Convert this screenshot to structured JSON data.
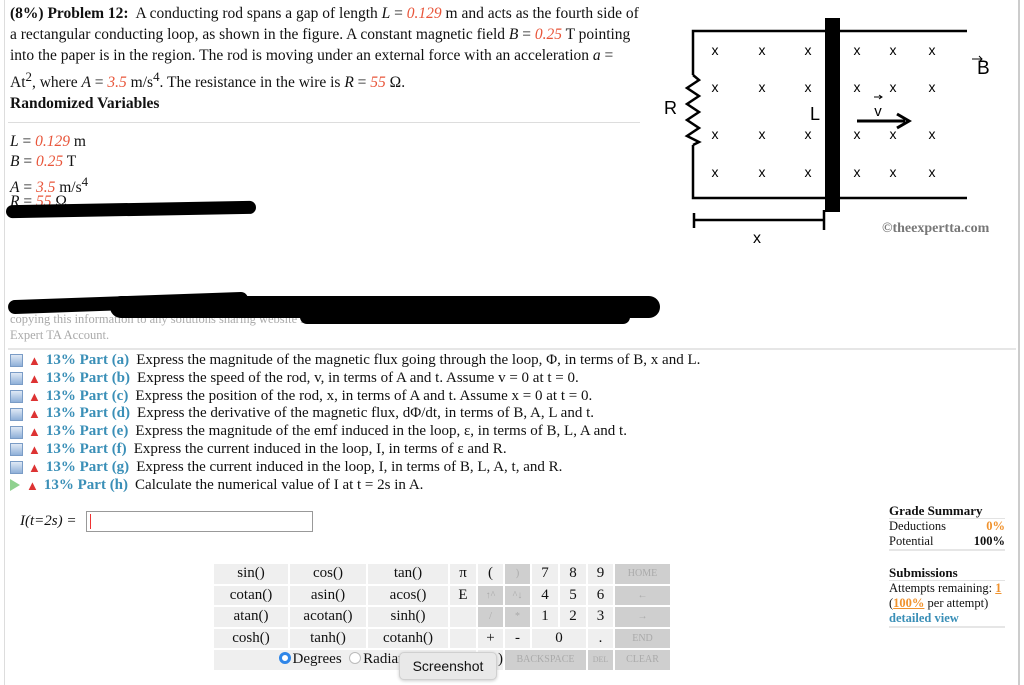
{
  "problem": {
    "weight": "(8%)",
    "title": "Problem 12:",
    "text_1": "A conducting rod spans a gap of length ",
    "L_sym": "L",
    "L_val": "0.129",
    "text_2": " m and acts as the fourth side of a rectangular conducting loop, as shown in the figure. A constant magnetic field ",
    "B_sym": "B",
    "B_val": "0.25",
    "text_3": " T pointing into the paper is in the region. The rod is moving under an external force with an acceleration ",
    "a_expr": "a",
    "a_rhs": " = At",
    "text_4": ", where ",
    "A_sym": "A",
    "A_val": "3.5",
    "text_5": " m/s",
    "text_6": ". The resistance in the wire is ",
    "R_sym": "R",
    "R_val": "55",
    "text_7": " Ω."
  },
  "randomized": {
    "heading": "Randomized Variables",
    "vars": [
      {
        "sym": "L",
        "val": "0.129",
        "unit": " m"
      },
      {
        "sym": "B",
        "val": "0.25",
        "unit": " T"
      },
      {
        "sym": "A",
        "val": "3.5",
        "unit": " m/s",
        "sup": "4"
      },
      {
        "sym": "R",
        "val": "55",
        "unit": " Ω"
      }
    ]
  },
  "notice": {
    "line1": "copying this information to any solutions sharing website is s",
    "line2": "Expert TA Account."
  },
  "figure": {
    "R": "R",
    "L": "L",
    "B": "B",
    "v": "v",
    "x": "x",
    "cross": "x",
    "copyright": "©theexpertta.com"
  },
  "parts": [
    {
      "icon": "box",
      "label": "13% Part (a)",
      "text": "Express the magnitude of the magnetic flux going through the loop, Φ, in terms of B, x and L."
    },
    {
      "icon": "box",
      "label": "13% Part (b)",
      "text": "Express the speed of the rod, v, in terms of A and t. Assume v = 0 at t = 0."
    },
    {
      "icon": "box",
      "label": "13% Part (c)",
      "text": "Express the position of the rod, x, in terms of A and t. Assume x = 0 at t = 0."
    },
    {
      "icon": "box",
      "label": "13% Part (d)",
      "text": "Express the derivative of the magnetic flux, dΦ/dt, in terms of B, A, L and t."
    },
    {
      "icon": "box",
      "label": "13% Part (e)",
      "text": "Express the magnitude of the emf induced in the loop, ε, in terms of B, L, A and t."
    },
    {
      "icon": "box",
      "label": "13% Part (f)",
      "text": "Express the current induced in the loop, I, in terms of ε and R."
    },
    {
      "icon": "box",
      "label": "13% Part (g)",
      "text": "Express the current induced in the loop, I, in terms of B, L, A, t, and R."
    },
    {
      "icon": "play",
      "label": "13% Part (h)",
      "text": "Calculate the numerical value of I at t = 2s in A."
    }
  ],
  "answer": {
    "label": "I(t=2s) = ",
    "value": ""
  },
  "keypad": {
    "rows": [
      [
        "sin()",
        "cos()",
        "tan()",
        "π",
        "(",
        ")",
        "7",
        "8",
        "9",
        "HOME"
      ],
      [
        "cotan()",
        "asin()",
        "acos()",
        "E",
        "↑^",
        "^↓",
        "4",
        "5",
        "6",
        "←"
      ],
      [
        "atan()",
        "acotan()",
        "sinh()",
        "",
        "/",
        "*",
        "1",
        "2",
        "3",
        "→"
      ],
      [
        "cosh()",
        "tanh()",
        "cotanh()",
        "",
        "+",
        "-",
        "0",
        ".",
        "END"
      ]
    ],
    "degrees": "Degrees",
    "radians": "Radians",
    "angle_mode": "Degrees",
    "paren": ")",
    "backspace": "BACKSPACE",
    "del": "DEL",
    "clear": "CLEAR"
  },
  "tooltip": "Screenshot",
  "grade_summary": {
    "heading": "Grade Summary",
    "deductions_label": "Deductions",
    "deductions": "0%",
    "potential_label": "Potential",
    "potential": "100%",
    "submissions_heading": "Submissions",
    "attempts_label": "Attempts remaining: ",
    "attempts": "1",
    "per_attempt_open": "(",
    "per_attempt_pct": "100%",
    "per_attempt_text": " per attempt)",
    "detailed_view": "detailed view"
  },
  "colors": {
    "variable": "#e8553a",
    "part_label": "#3a8fb7",
    "accent_orange": "#f0922d"
  }
}
